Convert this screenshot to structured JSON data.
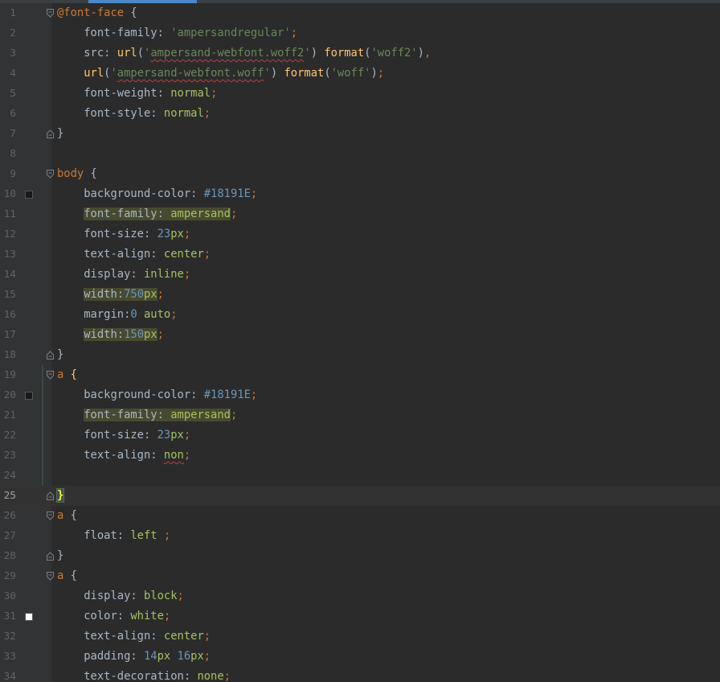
{
  "colors": {
    "swatch_dark": "#18191E",
    "swatch_white": "#FFFFFF",
    "accent": "#4a88c7"
  },
  "lines": [
    {
      "n": "1",
      "fold": "open",
      "tokens": [
        [
          "k",
          "@font-face"
        ],
        [
          "p",
          " {"
        ]
      ]
    },
    {
      "n": "2",
      "tokens": [
        [
          "p",
          "    font-family: "
        ],
        [
          "s",
          "'ampersandregular'"
        ],
        [
          "k",
          ";"
        ]
      ]
    },
    {
      "n": "3",
      "tokens": [
        [
          "p",
          "    src: "
        ],
        [
          "f",
          "url"
        ],
        [
          "p",
          "("
        ],
        [
          "s",
          "'"
        ],
        [
          "se",
          "ampersand-webfont.woff2"
        ],
        [
          "s",
          "'"
        ],
        [
          "p",
          ") "
        ],
        [
          "f",
          "format"
        ],
        [
          "p",
          "("
        ],
        [
          "s",
          "'woff2'"
        ],
        [
          "p",
          ")"
        ],
        [
          "k",
          ","
        ]
      ]
    },
    {
      "n": "4",
      "tokens": [
        [
          "p",
          "    "
        ],
        [
          "f",
          "url"
        ],
        [
          "p",
          "("
        ],
        [
          "s",
          "'"
        ],
        [
          "se",
          "ampersand-webfont.woff"
        ],
        [
          "s",
          "'"
        ],
        [
          "p",
          ") "
        ],
        [
          "f",
          "format"
        ],
        [
          "p",
          "("
        ],
        [
          "s",
          "'woff'"
        ],
        [
          "p",
          ")"
        ],
        [
          "k",
          ";"
        ]
      ]
    },
    {
      "n": "5",
      "tokens": [
        [
          "p",
          "    font-weight: "
        ],
        [
          "v",
          "normal"
        ],
        [
          "k",
          ";"
        ]
      ]
    },
    {
      "n": "6",
      "tokens": [
        [
          "p",
          "    font-style: "
        ],
        [
          "v",
          "normal"
        ],
        [
          "k",
          ";"
        ]
      ]
    },
    {
      "n": "7",
      "fold": "close",
      "tokens": [
        [
          "p",
          "}"
        ]
      ]
    },
    {
      "n": "8",
      "tokens": []
    },
    {
      "n": "9",
      "fold": "open",
      "tokens": [
        [
          "k",
          "body"
        ],
        [
          "p",
          " {"
        ]
      ]
    },
    {
      "n": "10",
      "swatch": "#18191E",
      "tokens": [
        [
          "p",
          "    background-color: "
        ],
        [
          "n",
          "#18191E"
        ],
        [
          "k",
          ";"
        ]
      ]
    },
    {
      "n": "11",
      "tokens": [
        [
          "p",
          "    "
        ],
        [
          "ph",
          "font-family: "
        ],
        [
          "vh",
          "ampersand"
        ],
        [
          "k",
          ";"
        ]
      ]
    },
    {
      "n": "12",
      "tokens": [
        [
          "p",
          "    font-size: "
        ],
        [
          "n",
          "23"
        ],
        [
          "v",
          "px"
        ],
        [
          "k",
          ";"
        ]
      ]
    },
    {
      "n": "13",
      "tokens": [
        [
          "p",
          "    text-align: "
        ],
        [
          "v",
          "center"
        ],
        [
          "k",
          ";"
        ]
      ]
    },
    {
      "n": "14",
      "tokens": [
        [
          "p",
          "    display: "
        ],
        [
          "v",
          "inline"
        ],
        [
          "k",
          ";"
        ]
      ]
    },
    {
      "n": "15",
      "tokens": [
        [
          "p",
          "    "
        ],
        [
          "ph",
          "width:"
        ],
        [
          "nh",
          "750"
        ],
        [
          "vh",
          "px"
        ],
        [
          "k",
          ";"
        ]
      ]
    },
    {
      "n": "16",
      "tokens": [
        [
          "p",
          "    margin:"
        ],
        [
          "n",
          "0"
        ],
        [
          "p",
          " "
        ],
        [
          "v",
          "auto"
        ],
        [
          "k",
          ";"
        ]
      ]
    },
    {
      "n": "17",
      "tokens": [
        [
          "p",
          "    "
        ],
        [
          "ph",
          "width:"
        ],
        [
          "nh",
          "150"
        ],
        [
          "vh",
          "px"
        ],
        [
          "k",
          ";"
        ]
      ]
    },
    {
      "n": "18",
      "fold": "close",
      "tokens": [
        [
          "p",
          "}"
        ]
      ]
    },
    {
      "n": "19",
      "fold": "open",
      "tokens": [
        [
          "k",
          "a"
        ],
        [
          "p",
          " "
        ],
        [
          "f",
          "{"
        ]
      ]
    },
    {
      "n": "20",
      "swatch": "#18191E",
      "tokens": [
        [
          "p",
          "    background-color: "
        ],
        [
          "n",
          "#18191E"
        ],
        [
          "k",
          ";"
        ]
      ]
    },
    {
      "n": "21",
      "tokens": [
        [
          "p",
          "    "
        ],
        [
          "ph",
          "font-family: "
        ],
        [
          "vh",
          "ampersand"
        ],
        [
          "k",
          ";"
        ]
      ]
    },
    {
      "n": "22",
      "tokens": [
        [
          "p",
          "    font-size: "
        ],
        [
          "n",
          "23"
        ],
        [
          "v",
          "px"
        ],
        [
          "k",
          ";"
        ]
      ]
    },
    {
      "n": "23",
      "tokens": [
        [
          "p",
          "    text-align: "
        ],
        [
          "ve",
          "non"
        ],
        [
          "k",
          ";"
        ]
      ]
    },
    {
      "n": "24",
      "tokens": []
    },
    {
      "n": "25",
      "fold": "close",
      "current": true,
      "tokens": [
        [
          "bm",
          "}"
        ]
      ]
    },
    {
      "n": "26",
      "fold": "open",
      "tokens": [
        [
          "k",
          "a"
        ],
        [
          "p",
          " {"
        ]
      ]
    },
    {
      "n": "27",
      "tokens": [
        [
          "p",
          "    float: "
        ],
        [
          "v",
          "left"
        ],
        [
          "p",
          " "
        ],
        [
          "k",
          ";"
        ]
      ]
    },
    {
      "n": "28",
      "fold": "close",
      "tokens": [
        [
          "p",
          "}"
        ]
      ]
    },
    {
      "n": "29",
      "fold": "open",
      "tokens": [
        [
          "k",
          "a"
        ],
        [
          "p",
          " {"
        ]
      ]
    },
    {
      "n": "30",
      "tokens": [
        [
          "p",
          "    display: "
        ],
        [
          "v",
          "block"
        ],
        [
          "k",
          ";"
        ]
      ]
    },
    {
      "n": "31",
      "swatch": "#FFFFFF",
      "tokens": [
        [
          "p",
          "    color: "
        ],
        [
          "v",
          "white"
        ],
        [
          "k",
          ";"
        ]
      ]
    },
    {
      "n": "32",
      "tokens": [
        [
          "p",
          "    text-align: "
        ],
        [
          "v",
          "center"
        ],
        [
          "k",
          ";"
        ]
      ]
    },
    {
      "n": "33",
      "tokens": [
        [
          "p",
          "    padding: "
        ],
        [
          "n",
          "14"
        ],
        [
          "v",
          "px"
        ],
        [
          "p",
          " "
        ],
        [
          "n",
          "16"
        ],
        [
          "v",
          "px"
        ],
        [
          "k",
          ";"
        ]
      ]
    },
    {
      "n": "34",
      "tokens": [
        [
          "p",
          "    text-decoration: "
        ],
        [
          "v",
          "none"
        ],
        [
          "k",
          ";"
        ]
      ]
    }
  ]
}
